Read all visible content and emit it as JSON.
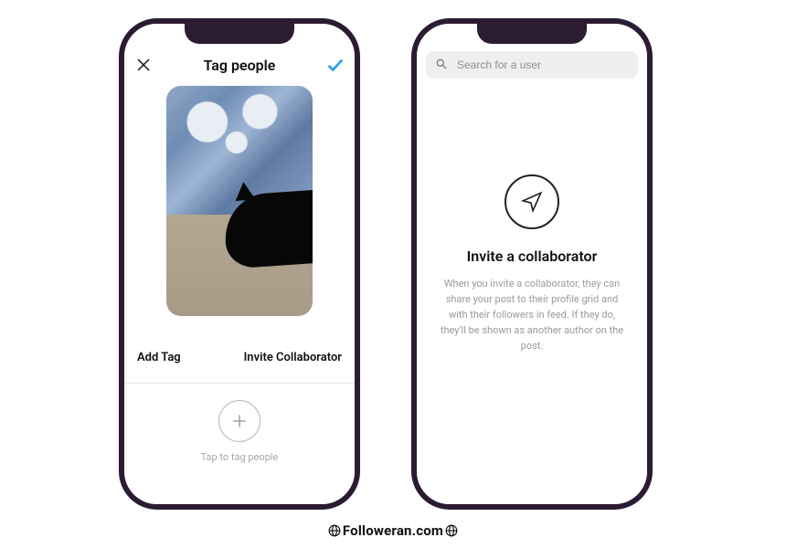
{
  "left": {
    "header": {
      "title": "Tag people"
    },
    "actions": {
      "add_tag": "Add Tag",
      "invite_collaborator": "Invite Collaborator"
    },
    "bottom": {
      "tap_text": "Tap to tag people"
    }
  },
  "right": {
    "search": {
      "placeholder": "Search for a user"
    },
    "collab": {
      "title": "Invite a collaborator",
      "description": "When you invite a collaborator, they can share your post to their profile grid and with their followers in feed. If they do, they'll be shown as another author on the post."
    }
  },
  "watermark": {
    "text": "Followeran.com"
  }
}
